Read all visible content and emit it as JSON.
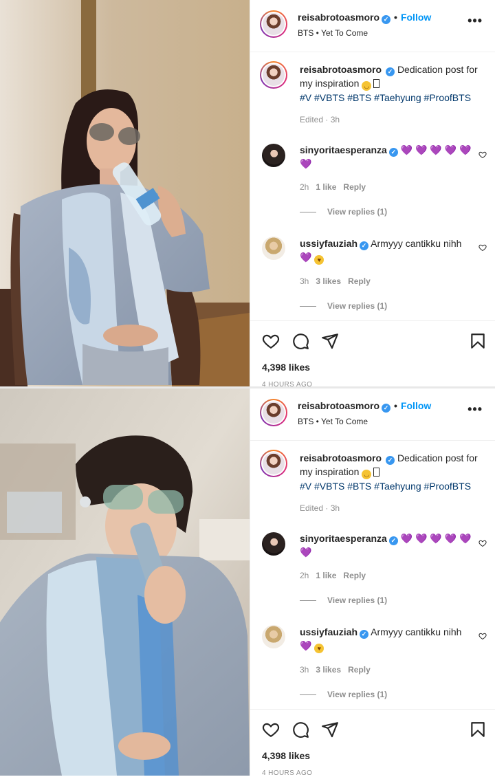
{
  "posts": [
    {
      "author": {
        "username": "reisabrotoasmoro",
        "follow_label": "Follow",
        "separator": "•",
        "subtitle": "BTS • Yet To Come"
      },
      "more_label": "•••",
      "caption": {
        "username": "reisabrotoasmoro",
        "text": "Dedication post for my inspiration",
        "hashtags": "#V #VBTS #BTS #Taehyung #ProofBTS",
        "edited": "Edited · 3h"
      },
      "comments": [
        {
          "username": "sinyoritaesperanza",
          "text": "💜 💜 💜 💜 💜 💜",
          "time": "2h",
          "likes": "1 like",
          "reply": "Reply",
          "view_replies": "View replies (1)"
        },
        {
          "username": "ussiyfauziah",
          "text": "Armyyy cantikku nihh 💜",
          "time": "3h",
          "likes": "3 likes",
          "reply": "Reply",
          "view_replies": "View replies (1)"
        }
      ],
      "likes": "4,398 likes",
      "time_ago": "4 HOURS AGO"
    },
    {
      "author": {
        "username": "reisabrotoasmoro",
        "follow_label": "Follow",
        "separator": "•",
        "subtitle": "BTS • Yet To Come"
      },
      "more_label": "•••",
      "caption": {
        "username": "reisabrotoasmoro",
        "text": "Dedication post for my inspiration",
        "hashtags": "#V #VBTS #BTS #Taehyung #ProofBTS",
        "edited": "Edited · 3h"
      },
      "comments": [
        {
          "username": "sinyoritaesperanza",
          "text": "💜 💜 💜 💜 💜 💜",
          "time": "2h",
          "likes": "1 like",
          "reply": "Reply",
          "view_replies": "View replies (1)"
        },
        {
          "username": "ussiyfauziah",
          "text": "Armyyy cantikku nihh 💜",
          "time": "3h",
          "likes": "3 likes",
          "reply": "Reply",
          "view_replies": "View replies (1)"
        }
      ],
      "likes": "4,398 likes",
      "time_ago": "4 HOURS AGO"
    }
  ],
  "icons": {
    "verified": "verified-badge-icon",
    "heart": "heart-icon",
    "comment": "comment-icon",
    "share": "share-icon",
    "save": "bookmark-icon"
  },
  "colors": {
    "follow": "#0095f6",
    "hashtag": "#00376b",
    "muted": "#8e8e8e",
    "verified": "#3897f0"
  }
}
